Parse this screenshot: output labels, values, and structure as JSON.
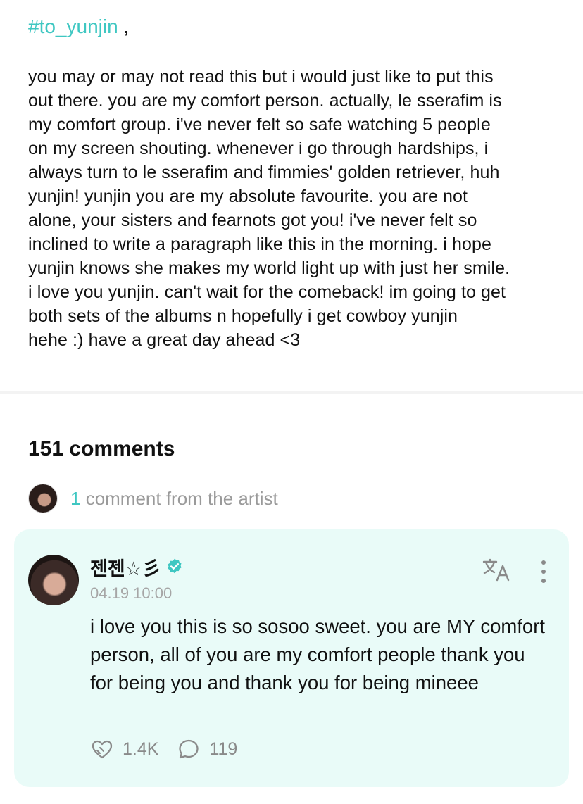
{
  "post": {
    "hashtag": "#to_yunjin",
    "hashtag_suffix": " ,",
    "body": "you may or may not read this but i would just like to put this\nout there. you are my comfort person. actually, le sserafim is\nmy comfort group. i've never felt so safe watching 5 people\non my screen shouting. whenever i go through hardships, i\nalways turn to le sserafim and fimmies' golden retriever, huh\nyunjin! yunjin you are my absolute favourite. you are not\nalone, your sisters and fearnots got you! i've never felt so\ninclined to write a paragraph like this in the morning. i hope\nyunjin knows she makes my world light up with just her smile.\ni love you yunjin. can't wait for the comeback! im going to get\nboth sets of the albums n hopefully i get cowboy yunjin\nhehe :) have a great day ahead <3"
  },
  "comments": {
    "count_label": "151 comments",
    "artist_count": "1",
    "artist_label": " comment from the artist"
  },
  "artist_comment": {
    "author": "젠젠☆彡",
    "timestamp": "04.19 10:00",
    "text": "i love you this is so sosoo sweet. you are MY comfort person, all of you are my comfort people thank you for being you and thank you for being mineee",
    "likes": "1.4K",
    "replies": "119"
  },
  "icons": {
    "verified": "verified-badge-icon",
    "translate": "translate-icon",
    "more": "more-vertical-icon",
    "like": "heart-like-icon",
    "reply": "comment-bubble-icon"
  },
  "colors": {
    "accent": "#3fc7c2",
    "card_background": "#e9fbf8",
    "muted_text": "#9a9a9a"
  }
}
